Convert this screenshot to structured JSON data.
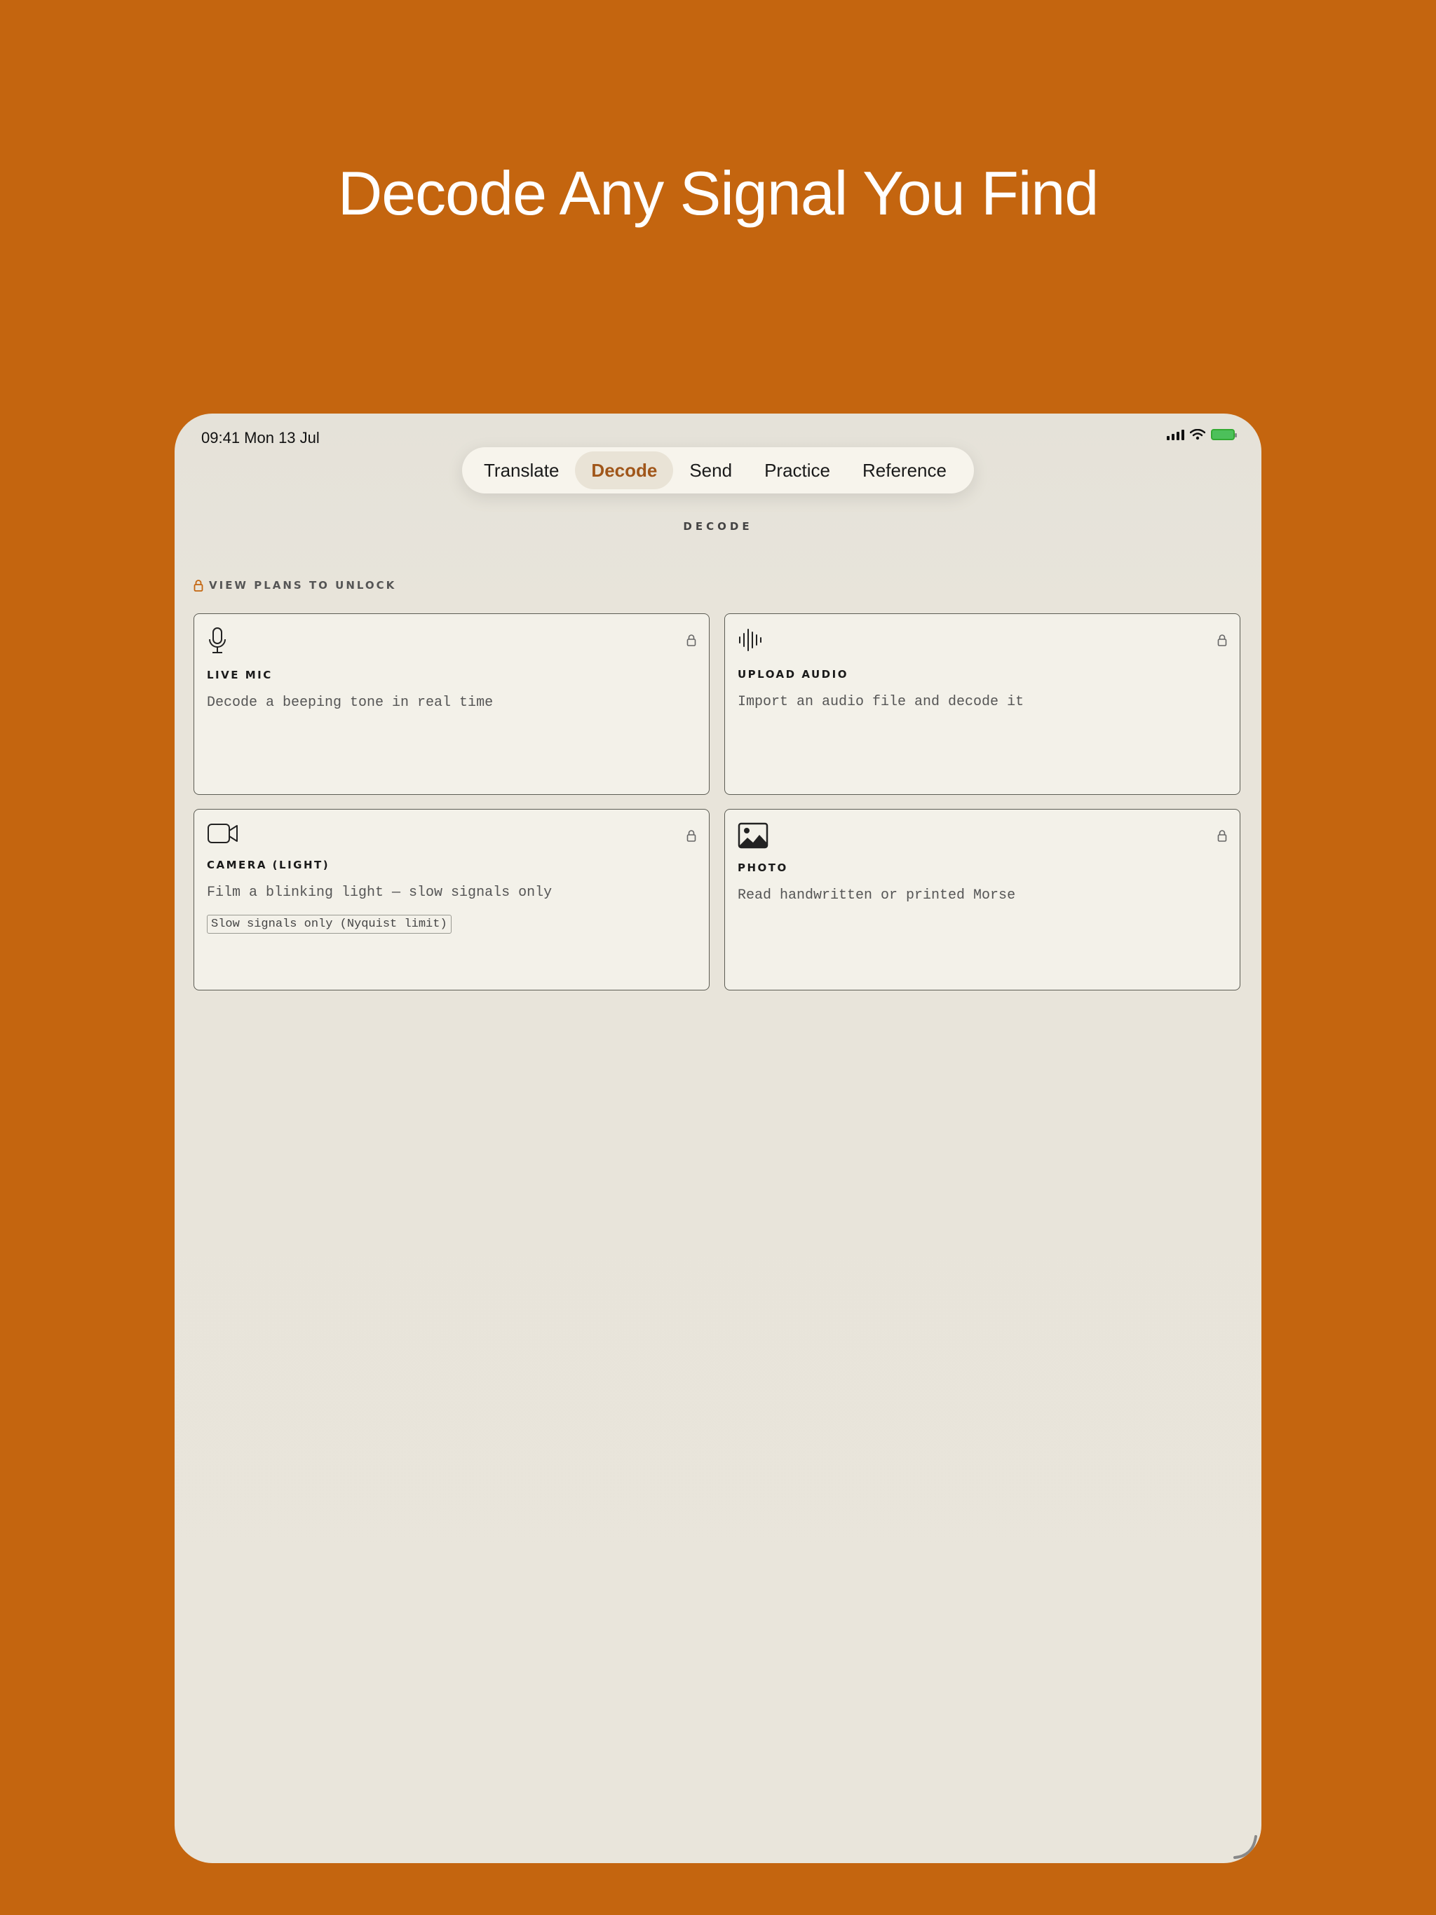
{
  "headline": "Decode Any Signal You Find",
  "status": {
    "time_date": "09:41  Mon 13 Jul"
  },
  "tabs": [
    {
      "label": "Translate",
      "active": false
    },
    {
      "label": "Decode",
      "active": true
    },
    {
      "label": "Send",
      "active": false
    },
    {
      "label": "Practice",
      "active": false
    },
    {
      "label": "Reference",
      "active": false
    }
  ],
  "section_title": "DECODE",
  "unlock_label": "VIEW PLANS TO UNLOCK",
  "cards": [
    {
      "icon": "microphone-icon",
      "title": "LIVE MIC",
      "description": "Decode a beeping tone in real time",
      "locked": true
    },
    {
      "icon": "waveform-icon",
      "title": "UPLOAD AUDIO",
      "description": "Import an audio file and decode it",
      "locked": true
    },
    {
      "icon": "video-camera-icon",
      "title": "CAMERA (LIGHT)",
      "description": "Film a blinking light — slow signals only",
      "tag": "Slow signals only (Nyquist limit)",
      "locked": true
    },
    {
      "icon": "photo-icon",
      "title": "PHOTO",
      "description": "Read handwritten or printed Morse",
      "locked": true
    }
  ],
  "colors": {
    "background": "#C4650F",
    "accent": "#A0561A",
    "screen": "#E8E4DA",
    "card": "#F3F1E9"
  }
}
